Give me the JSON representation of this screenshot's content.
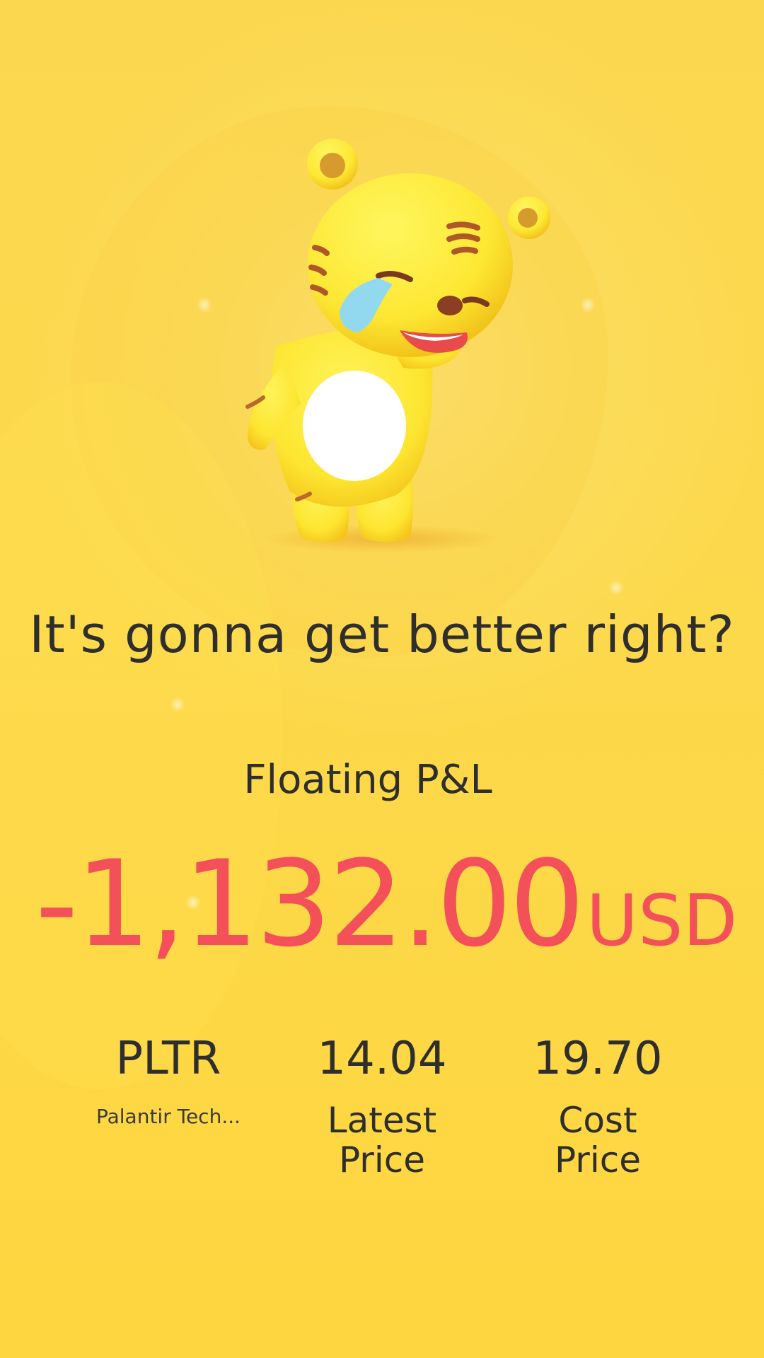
{
  "headline": "It's gonna get better right?",
  "pl": {
    "label": "Floating P&L",
    "amount": "-1,132.00",
    "currency": "USD"
  },
  "stock": {
    "ticker": "PLTR",
    "name": "Palantir Tech..."
  },
  "latest": {
    "value": "14.04",
    "label": "Latest Price"
  },
  "cost": {
    "value": "19.70",
    "label": "Cost Price"
  },
  "colors": {
    "background": "#fcd94c",
    "loss": "#f4505a",
    "text": "#2e2e2e"
  },
  "mascot": "crying-tiger-mascot"
}
